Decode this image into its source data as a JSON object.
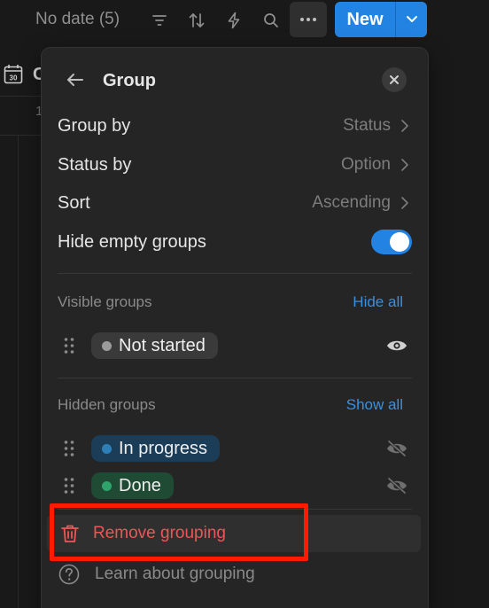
{
  "toolbar": {
    "view_label": "No date (5)",
    "icons": [
      "filter-icon",
      "sort-icon",
      "automation-icon",
      "search-icon",
      "more-icon"
    ],
    "new_label": "New",
    "accent": "#2383e2"
  },
  "background": {
    "view_letter": "C",
    "row_number": "1"
  },
  "panel": {
    "title": "Group",
    "settings": [
      {
        "label": "Group by",
        "value": "Status"
      },
      {
        "label": "Status by",
        "value": "Option"
      },
      {
        "label": "Sort",
        "value": "Ascending"
      }
    ],
    "hide_empty": {
      "label": "Hide empty groups",
      "enabled": true
    },
    "visible_section": {
      "label": "Visible groups",
      "action": "Hide all",
      "groups": [
        {
          "name": "Not started",
          "dot_color": "#9b9b9b",
          "bg_color": "#3a3a3a",
          "visible": true
        }
      ]
    },
    "hidden_section": {
      "label": "Hidden groups",
      "action": "Show all",
      "groups": [
        {
          "name": "In progress",
          "dot_color": "#2e7fb8",
          "bg_color": "#1c3d57",
          "visible": false
        },
        {
          "name": "Done",
          "dot_color": "#2fa36b",
          "bg_color": "#1f4a33",
          "visible": false
        }
      ]
    },
    "remove_label": "Remove grouping",
    "learn_label": "Learn about grouping",
    "danger_color": "#eb5757"
  }
}
